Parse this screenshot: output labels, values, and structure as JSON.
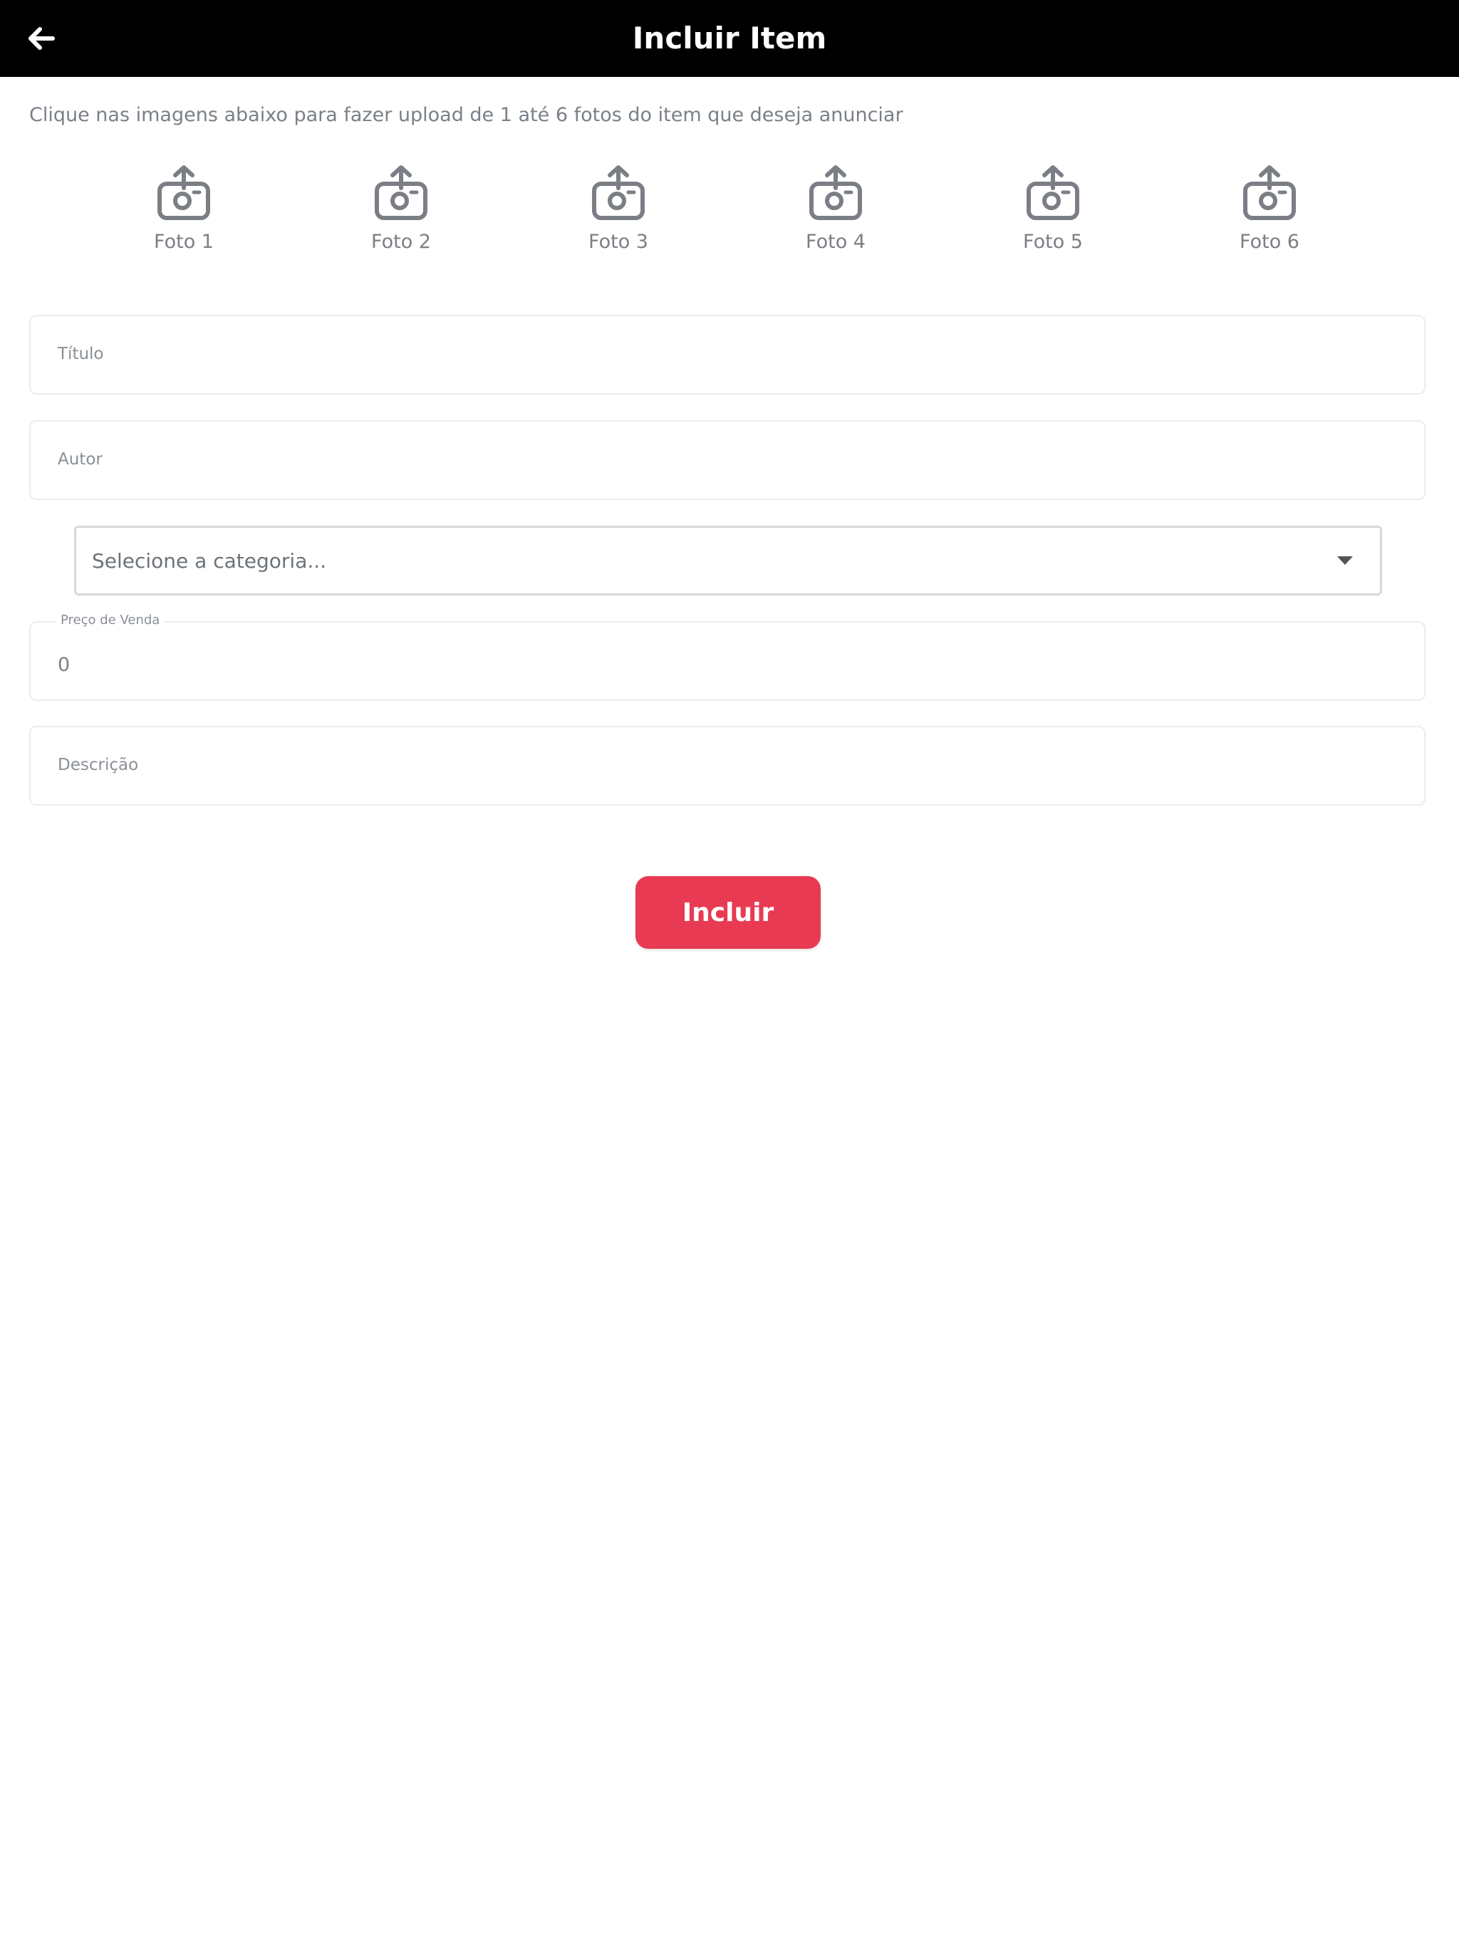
{
  "header": {
    "title": "Incluir Item",
    "back_icon": "arrow-left-icon",
    "background": "#000000",
    "text_color": "#ffffff"
  },
  "instructions": "Clique nas imagens abaixo para fazer upload de 1 até 6 fotos do item que deseja anunciar",
  "photos": [
    {
      "label": "Foto 1",
      "icon": "camera-upload-icon"
    },
    {
      "label": "Foto 2",
      "icon": "camera-upload-icon"
    },
    {
      "label": "Foto 3",
      "icon": "camera-upload-icon"
    },
    {
      "label": "Foto 4",
      "icon": "camera-upload-icon"
    },
    {
      "label": "Foto 5",
      "icon": "camera-upload-icon"
    },
    {
      "label": "Foto 6",
      "icon": "camera-upload-icon"
    }
  ],
  "form": {
    "title_label": "Título",
    "author_label": "Autor",
    "category_placeholder": "Selecione a categoria...",
    "price_label": "Preço de Venda",
    "price_value": "0",
    "description_label": "Descrição"
  },
  "submit": {
    "label": "Incluir",
    "color": "#e83a52"
  }
}
